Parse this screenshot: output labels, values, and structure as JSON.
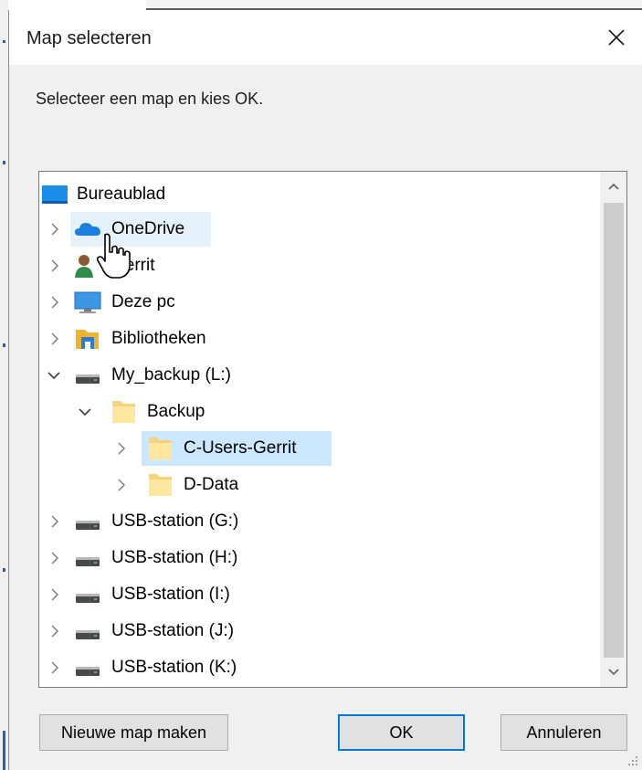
{
  "dialog": {
    "title": "Map selecteren",
    "instruction": "Selecteer een map en kies OK."
  },
  "tree": {
    "items": [
      {
        "label": "Bureaublad",
        "icon": "desktop-icon",
        "chevron": "none"
      },
      {
        "label": "OneDrive",
        "icon": "onedrive-cloud-icon",
        "chevron": "right",
        "hovered": true
      },
      {
        "label": "Gerrit",
        "icon": "user-icon",
        "chevron": "right"
      },
      {
        "label": "Deze pc",
        "icon": "computer-icon",
        "chevron": "right"
      },
      {
        "label": "Bibliotheken",
        "icon": "libraries-icon",
        "chevron": "right"
      },
      {
        "label": "My_backup (L:)",
        "icon": "drive-icon",
        "chevron": "down"
      },
      {
        "label": "Backup",
        "icon": "folder-icon",
        "chevron": "down"
      },
      {
        "label": "C-Users-Gerrit",
        "icon": "folder-icon",
        "chevron": "right",
        "selected": true
      },
      {
        "label": "D-Data",
        "icon": "folder-icon",
        "chevron": "right"
      },
      {
        "label": "USB-station (G:)",
        "icon": "drive-icon",
        "chevron": "right"
      },
      {
        "label": "USB-station (H:)",
        "icon": "drive-icon",
        "chevron": "right"
      },
      {
        "label": "USB-station (I:)",
        "icon": "drive-icon",
        "chevron": "right"
      },
      {
        "label": "USB-station (J:)",
        "icon": "drive-icon",
        "chevron": "right"
      },
      {
        "label": "USB-station (K:)",
        "icon": "drive-icon",
        "chevron": "right"
      }
    ]
  },
  "buttons": {
    "new_folder": "Nieuwe map maken",
    "ok": "OK",
    "cancel": "Annuleren"
  },
  "colors": {
    "selection": "#cce8ff",
    "hover": "#e5f1fb",
    "accent": "#0078d7"
  }
}
